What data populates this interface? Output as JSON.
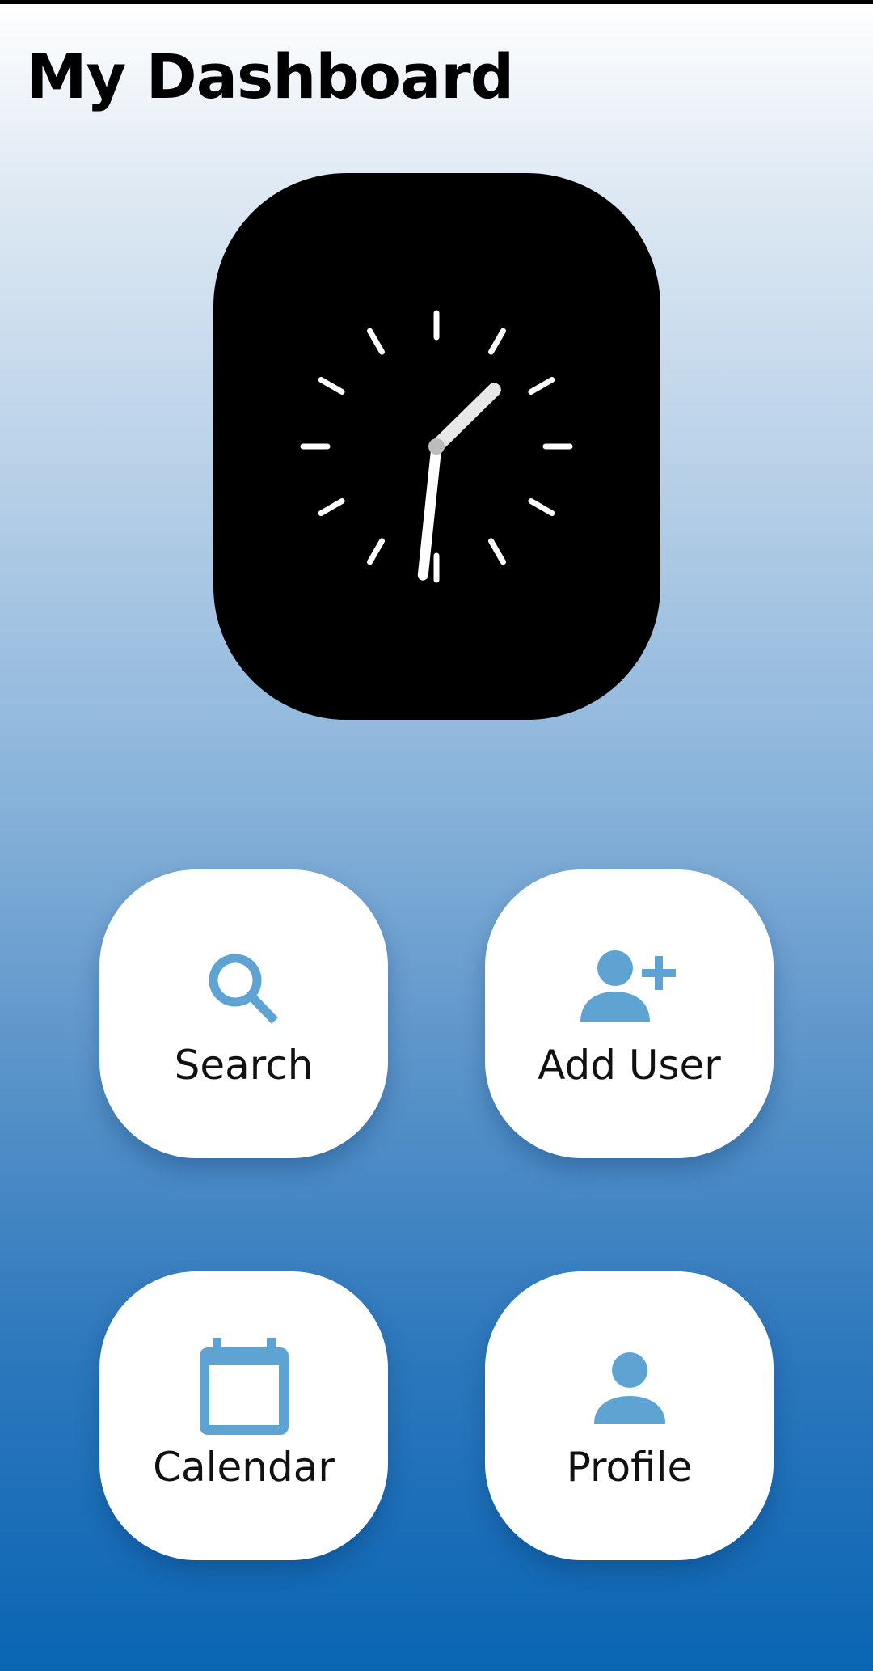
{
  "header": {
    "title": "My Dashboard"
  },
  "clock": {
    "hour": 1,
    "minute": 31,
    "face_color": "#000000",
    "mark_color": "#ffffff"
  },
  "tiles": [
    {
      "label": "Search",
      "icon": "search-icon"
    },
    {
      "label": "Add User",
      "icon": "add-user-icon"
    },
    {
      "label": "Calendar",
      "icon": "calendar-icon"
    },
    {
      "label": "Profile",
      "icon": "profile-icon"
    }
  ],
  "colors": {
    "accent": "#5fa3d3",
    "background_top": "#ffffff",
    "background_bottom": "#0a65b3",
    "tile_background": "#ffffff"
  }
}
